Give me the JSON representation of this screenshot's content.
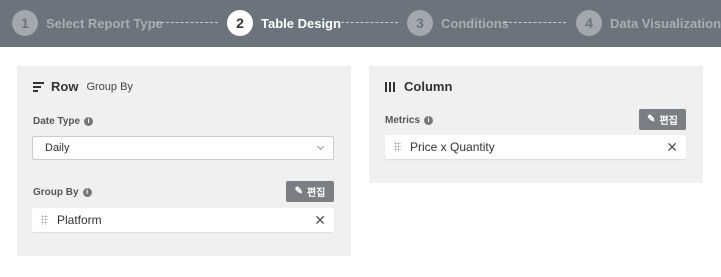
{
  "stepper": {
    "steps": [
      {
        "num": "1",
        "label": "Select Report Type"
      },
      {
        "num": "2",
        "label": "Table Design"
      },
      {
        "num": "3",
        "label": "Conditions"
      },
      {
        "num": "4",
        "label": "Data Visualization"
      }
    ],
    "active_step": 2
  },
  "row_panel": {
    "title": "Row",
    "subtitle": "Group By",
    "date_type_label": "Date Type",
    "date_type_value": "Daily",
    "group_by_label": "Group By",
    "edit_label": "편집",
    "items": [
      "Platform"
    ]
  },
  "column_panel": {
    "title": "Column",
    "metrics_label": "Metrics",
    "edit_label": "편집",
    "items": [
      "Price x Quantity"
    ]
  },
  "icons": {
    "info": "i",
    "close": "✕",
    "pencil": "✎"
  },
  "colors": {
    "stepper_bg": "#6b737c",
    "panel_bg": "#f0f0f0",
    "edit_button": "#7a7f85"
  }
}
